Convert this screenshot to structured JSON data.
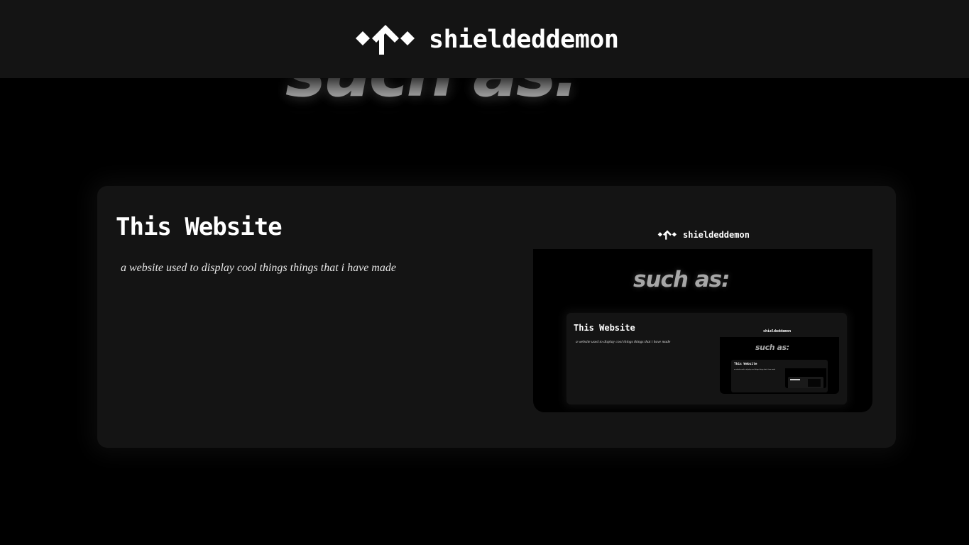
{
  "header": {
    "brand": "shieldeddemon",
    "logo_icon": "shieldeddemon-logo-icon"
  },
  "hero": {
    "heading": "such as:"
  },
  "projects": [
    {
      "title": "This Website",
      "description": "a website used to display cool things things that i have made",
      "preview": {
        "brand": "shieldeddemon",
        "heading": "such as:",
        "card_title": "This Website",
        "card_description": "a website used to display cool things things that i have made",
        "nested": {
          "brand": "shieldeddemon",
          "heading": "such as:",
          "card_title": "This Website",
          "card_description": "a website used to display cool things things that i have made"
        }
      }
    }
  ],
  "colors": {
    "background": "#000000",
    "header_bg": "#141414",
    "card_bg": "#141414",
    "text_primary": "#ffffff",
    "hero_text": "#a7a7a7"
  }
}
